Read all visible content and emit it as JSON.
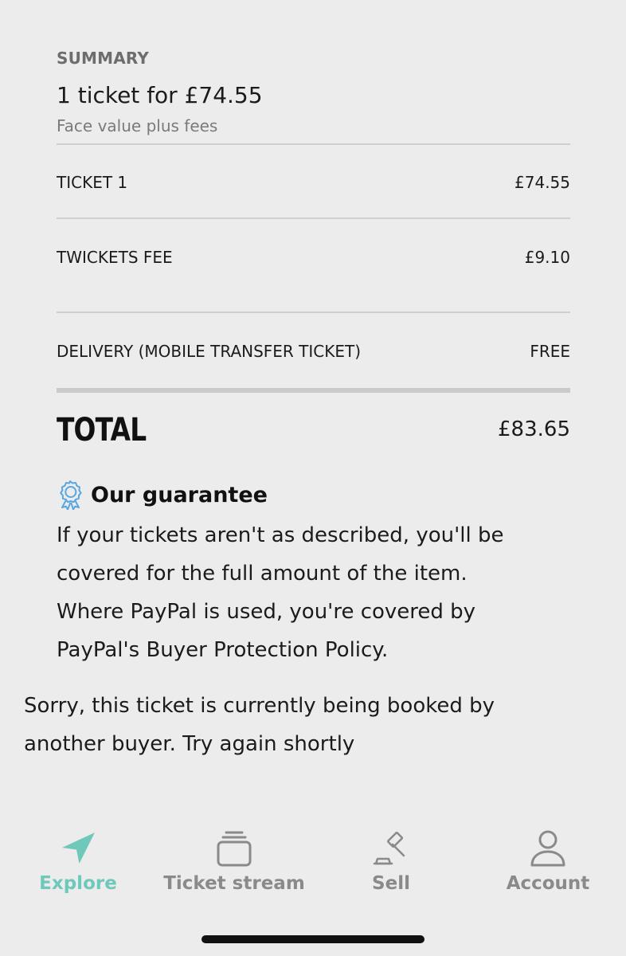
{
  "summary": {
    "section_label": "SUMMARY",
    "headline": "1 ticket for £74.55",
    "subline": "Face value plus fees"
  },
  "line_items": [
    {
      "label": "TICKET 1",
      "value": "£74.55"
    },
    {
      "label": "TWICKETS FEE",
      "value": "£9.10"
    },
    {
      "label": "DELIVERY (MOBILE TRANSFER TICKET)",
      "value": "FREE"
    }
  ],
  "total": {
    "label": "TOTAL",
    "value": "£83.65"
  },
  "guarantee": {
    "icon": "award-ribbon-icon",
    "title": "Our guarantee",
    "body_lines": [
      "If your tickets aren't as described, you'll be",
      "covered for the full amount of the item.",
      "Where PayPal is used, you're covered by",
      "PayPal's Buyer Protection Policy."
    ]
  },
  "error_message": {
    "lines": [
      "Sorry, this ticket is currently being booked by",
      "another buyer. Try again shortly"
    ]
  },
  "tabbar": {
    "tabs": [
      {
        "label": "Explore",
        "icon": "navigation-arrow-icon",
        "active": true
      },
      {
        "label": "Ticket stream",
        "icon": "ticket-stack-icon",
        "active": false
      },
      {
        "label": "Sell",
        "icon": "gavel-icon",
        "active": false
      },
      {
        "label": "Account",
        "icon": "user-icon",
        "active": false
      }
    ]
  },
  "colors": {
    "background": "#ececec",
    "accent": "#6fc8ba",
    "guarantee_icon": "#5aa6e0",
    "inactive_tab": "#8a8a8a"
  }
}
